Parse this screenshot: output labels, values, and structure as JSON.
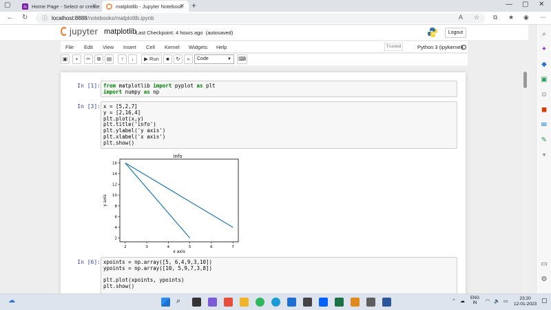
{
  "browser": {
    "tabs": [
      {
        "title": "Home Page - Select or create a n",
        "active": false
      },
      {
        "title": "matplotlib - Jupyter Notebook",
        "active": true
      }
    ],
    "url_host": "localhost:8888",
    "url_path": "/notebooks/matplotlib.ipynb"
  },
  "jupyter": {
    "logo_text": "jupyter",
    "notebook_name": "matplotlib",
    "checkpoint": "Last Checkpoint: 4 hours ago",
    "autosaved": "(autosaved)",
    "logout": "Logout",
    "menu": [
      "File",
      "Edit",
      "View",
      "Insert",
      "Cell",
      "Kernel",
      "Widgets",
      "Help"
    ],
    "trusted": "Trusted",
    "kernel": "Python 3 (ipykernel)",
    "run_label": "Run",
    "cell_type": "Code"
  },
  "cells": [
    {
      "prompt": "In [1]:",
      "lines": [
        "from matplotlib import pyplot as plt",
        "import numpy as np"
      ]
    },
    {
      "prompt": "In [3]:",
      "lines": [
        "x = [5,2,7]",
        "y = [2,16,4]",
        "plt.plot(x,y)",
        "plt.title('info')",
        "plt.ylabel('y axis')",
        "plt.xlabel('x axis')",
        "plt.show()"
      ]
    },
    {
      "prompt": "In [6]:",
      "lines": [
        "xpoints = np.array([5, 6,4,9,3,10])",
        "ypoints = np.array([10, 5,9,7,3,8])",
        "",
        "plt.plot(xpoints, ypoints)",
        "plt.show()"
      ]
    }
  ],
  "chart_data": {
    "type": "line",
    "title": "info",
    "xlabel": "x axis",
    "ylabel": "y axis",
    "x": [
      5,
      2,
      7
    ],
    "y": [
      2,
      16,
      4
    ],
    "xlim": [
      1.75,
      7.25
    ],
    "ylim": [
      1.3,
      16.7
    ],
    "xticks": [
      2,
      3,
      4,
      5,
      6,
      7
    ],
    "yticks": [
      2,
      4,
      6,
      8,
      10,
      12,
      14,
      16
    ],
    "line_color": "#1f77b4"
  },
  "taskbar": {
    "lang_top": "ENG",
    "lang_bottom": "IN",
    "time": "23:20",
    "date": "12-01-2023"
  }
}
